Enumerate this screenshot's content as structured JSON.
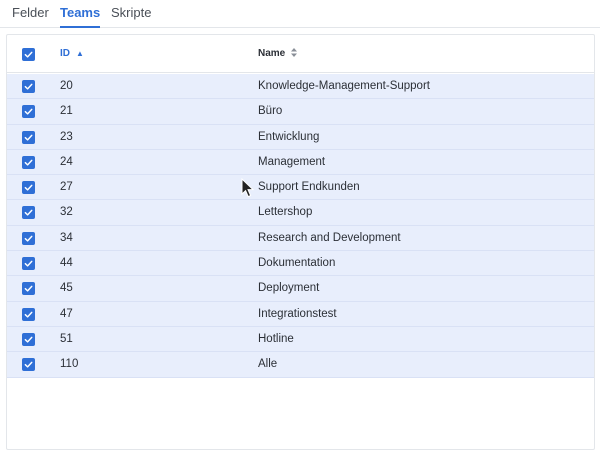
{
  "tabs": [
    {
      "label": "Felder",
      "active": false
    },
    {
      "label": "Teams",
      "active": true
    },
    {
      "label": "Skripte",
      "active": false
    }
  ],
  "table": {
    "select_all_checked": true,
    "columns": [
      {
        "label": "ID",
        "sort": "ascending"
      },
      {
        "label": "Name",
        "sort": "none"
      }
    ],
    "rows": [
      {
        "id": "20",
        "name": "Knowledge-Management-Support",
        "checked": true
      },
      {
        "id": "21",
        "name": "Büro",
        "checked": true
      },
      {
        "id": "23",
        "name": "Entwicklung",
        "checked": true
      },
      {
        "id": "24",
        "name": "Management",
        "checked": true
      },
      {
        "id": "27",
        "name": "Support Endkunden",
        "checked": true
      },
      {
        "id": "32",
        "name": "Lettershop",
        "checked": true
      },
      {
        "id": "34",
        "name": "Research and Development",
        "checked": true
      },
      {
        "id": "44",
        "name": "Dokumentation",
        "checked": true
      },
      {
        "id": "45",
        "name": "Deployment",
        "checked": true
      },
      {
        "id": "47",
        "name": "Integrationstest",
        "checked": true
      },
      {
        "id": "51",
        "name": "Hotline",
        "checked": true
      },
      {
        "id": "110",
        "name": "Alle",
        "checked": true
      }
    ]
  },
  "colors": {
    "accent": "#2f6fd6",
    "row_selected_bg": "#e8eefc"
  },
  "icons": {
    "sort_asc": "sort-ascending-icon",
    "sort_both": "sort-both-icon",
    "check": "checkmark-icon",
    "cursor": "mouse-pointer-icon"
  }
}
